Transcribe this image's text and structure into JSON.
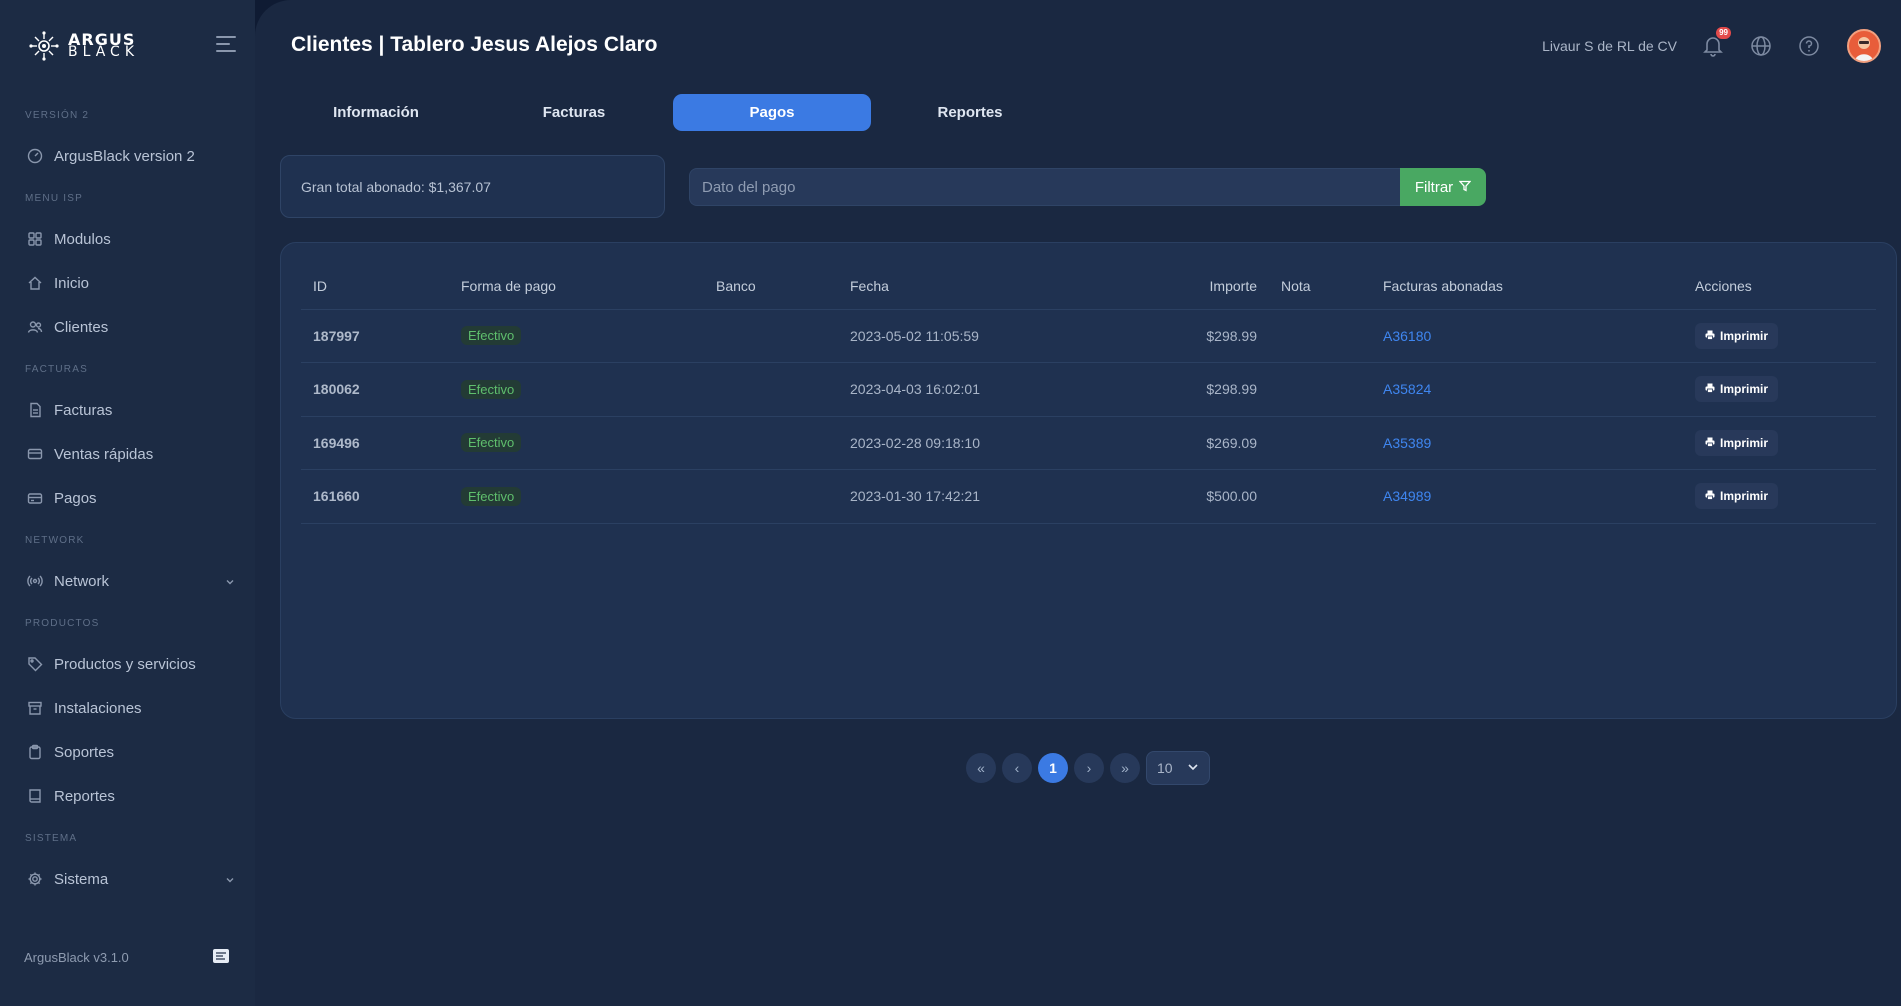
{
  "app": {
    "logo_top": "ARGUS",
    "logo_bottom": "BLACK",
    "version_footer": "ArgusBlack v3.1.0"
  },
  "sidebar": {
    "sections": {
      "version": "VERSIÓN 2",
      "menu_isp": "MENU ISP",
      "facturas": "FACTURAS",
      "network": "NETWORK",
      "productos": "PRODUCTOS",
      "sistema": "SISTEMA"
    },
    "items": {
      "argusblack_v2": "ArgusBlack version 2",
      "modulos": "Modulos",
      "inicio": "Inicio",
      "clientes": "Clientes",
      "facturas": "Facturas",
      "ventas_rapidas": "Ventas rápidas",
      "pagos": "Pagos",
      "network": "Network",
      "productos": "Productos y servicios",
      "instalaciones": "Instalaciones",
      "soportes": "Soportes",
      "reportes": "Reportes",
      "sistema": "Sistema"
    }
  },
  "header": {
    "title": "Clientes | Tablero Jesus Alejos Claro",
    "company": "Livaur S de RL de CV",
    "notification_count": "99"
  },
  "tabs": [
    "Información",
    "Facturas",
    "Pagos",
    "Reportes"
  ],
  "summary": {
    "grand_total": "Gran total abonado: $1,367.07"
  },
  "search": {
    "placeholder": "Dato del pago",
    "value": "",
    "filter_label": "Filtrar"
  },
  "table": {
    "headers": [
      "ID",
      "Forma de pago",
      "Banco",
      "Fecha",
      "Importe",
      "Nota",
      "Facturas abonadas",
      "Acciones"
    ],
    "rows": [
      {
        "id": "187997",
        "forma": "Efectivo",
        "banco": "",
        "fecha": "2023-05-02 11:05:59",
        "importe": "$298.99",
        "nota": "",
        "factura": "A36180",
        "accion": "Imprimir"
      },
      {
        "id": "180062",
        "forma": "Efectivo",
        "banco": "",
        "fecha": "2023-04-03 16:02:01",
        "importe": "$298.99",
        "nota": "",
        "factura": "A35824",
        "accion": "Imprimir"
      },
      {
        "id": "169496",
        "forma": "Efectivo",
        "banco": "",
        "fecha": "2023-02-28 09:18:10",
        "importe": "$269.09",
        "nota": "",
        "factura": "A35389",
        "accion": "Imprimir"
      },
      {
        "id": "161660",
        "forma": "Efectivo",
        "banco": "",
        "fecha": "2023-01-30 17:42:21",
        "importe": "$500.00",
        "nota": "",
        "factura": "A34989",
        "accion": "Imprimir"
      }
    ]
  },
  "pagination": {
    "first": "«",
    "prev": "‹",
    "current": "1",
    "next": "›",
    "last": "»",
    "page_size": "10"
  },
  "colors": {
    "accent": "#3b7ae3",
    "success": "#49a862",
    "link": "#3f86f0",
    "badge_text": "#5fbf6d"
  }
}
